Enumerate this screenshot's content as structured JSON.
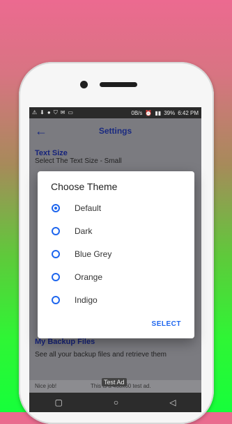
{
  "status": {
    "left_icons": [
      "warning-icon",
      "download-icon",
      "chat-icon",
      "shield-icon",
      "mail-icon",
      "message-icon"
    ],
    "speed": "0B/s",
    "battery": "39%",
    "time": "6:42 PM"
  },
  "appbar": {
    "title": "Settings"
  },
  "settings": {
    "text_size": {
      "title": "Text Size",
      "subtitle": "Select The Text Size - Small"
    },
    "backup": {
      "title": "My Backup Files",
      "subtitle": "See all your backup files and retrieve them"
    }
  },
  "dialog": {
    "title": "Choose Theme",
    "options": [
      "Default",
      "Dark",
      "Blue Grey",
      "Orange",
      "Indigo"
    ],
    "selected": "Default",
    "select_label": "SELECT"
  },
  "ad": {
    "badge": "Test Ad",
    "left": "Nice job!",
    "right": "This is a 468x60 test ad."
  },
  "colors": {
    "accent": "#1e66ee",
    "heading": "#16237a"
  }
}
